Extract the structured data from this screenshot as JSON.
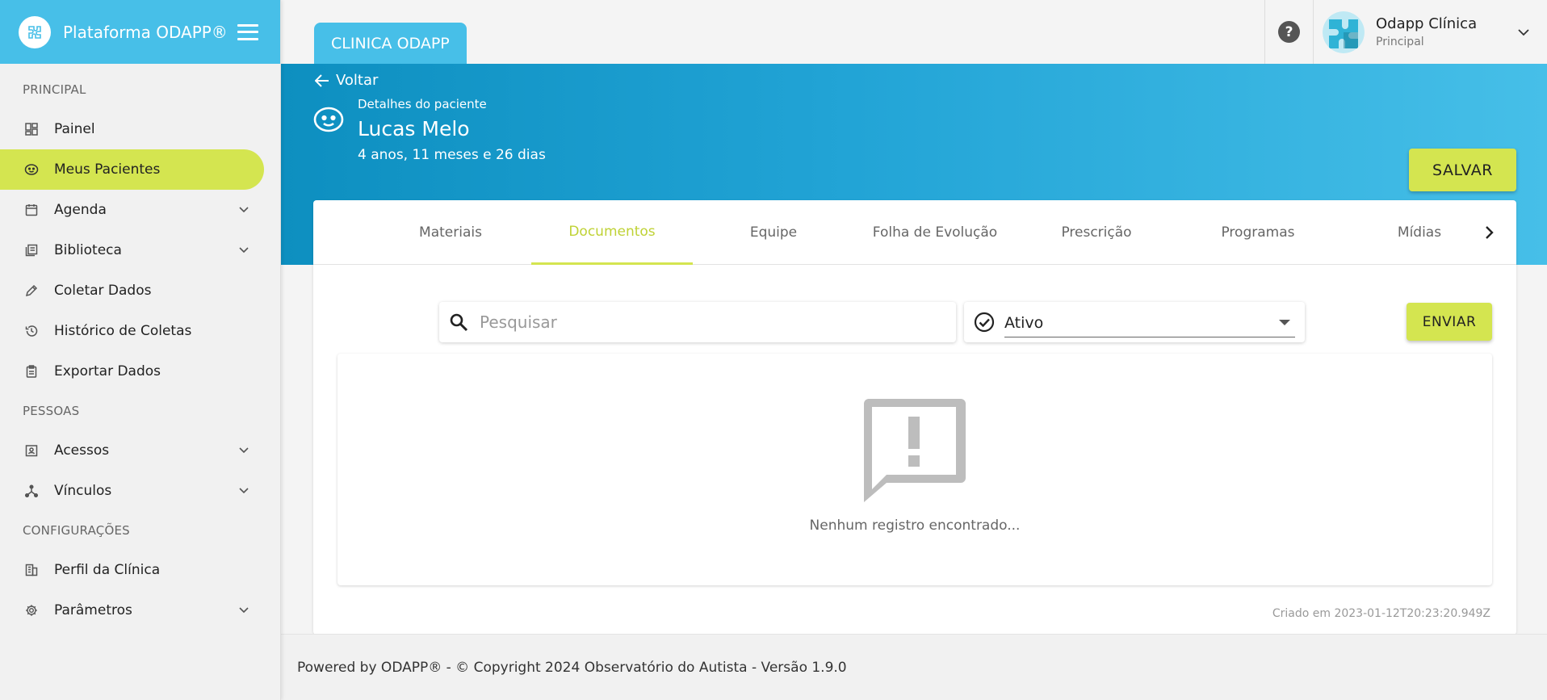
{
  "brand": {
    "title": "Plataforma ODAPP®"
  },
  "sidebar": {
    "sections": [
      {
        "label": "PRINCIPAL"
      },
      {
        "label": "PESSOAS"
      },
      {
        "label": "CONFIGURAÇÕES"
      }
    ],
    "items": [
      {
        "label": "Painel",
        "icon": "dashboard-icon",
        "active": false,
        "expandable": false
      },
      {
        "label": "Meus Pacientes",
        "icon": "patient-face-icon",
        "active": true,
        "expandable": false
      },
      {
        "label": "Agenda",
        "icon": "calendar-icon",
        "active": false,
        "expandable": true
      },
      {
        "label": "Biblioteca",
        "icon": "library-icon",
        "active": false,
        "expandable": true
      },
      {
        "label": "Coletar Dados",
        "icon": "pencil-icon",
        "active": false,
        "expandable": false
      },
      {
        "label": "Histórico de Coletas",
        "icon": "history-icon",
        "active": false,
        "expandable": false
      },
      {
        "label": "Exportar Dados",
        "icon": "clipboard-icon",
        "active": false,
        "expandable": false
      },
      {
        "label": "Acessos",
        "icon": "contact-card-icon",
        "active": false,
        "expandable": true
      },
      {
        "label": "Vínculos",
        "icon": "network-icon",
        "active": false,
        "expandable": true
      },
      {
        "label": "Perfil da Clínica",
        "icon": "building-icon",
        "active": false,
        "expandable": false
      },
      {
        "label": "Parâmetros",
        "icon": "gear-icon",
        "active": false,
        "expandable": true
      }
    ]
  },
  "topbar": {
    "clinic_tab": "CLINICA ODAPP",
    "user": {
      "name": "Odapp Clínica",
      "role": "Principal"
    }
  },
  "header": {
    "back_label": "Voltar",
    "caption": "Detalhes do paciente",
    "patient_name": "Lucas Melo",
    "patient_age": "4 anos, 11 meses e 26 dias",
    "save_label": "SALVAR"
  },
  "tabs": [
    {
      "label": "Materiais",
      "active": false
    },
    {
      "label": "Documentos",
      "active": true
    },
    {
      "label": "Equipe",
      "active": false
    },
    {
      "label": "Folha de Evolução",
      "active": false
    },
    {
      "label": "Prescrição",
      "active": false
    },
    {
      "label": "Programas",
      "active": false
    },
    {
      "label": "Mídias",
      "active": false
    }
  ],
  "toolbar": {
    "search_placeholder": "Pesquisar",
    "status_value": "Ativo",
    "send_label": "ENVIAR"
  },
  "empty_state": {
    "message": "Nenhum registro encontrado..."
  },
  "created_at": "Criado em 2023-01-12T20:23:20.949Z",
  "footer": {
    "text": "Powered by ODAPP® - © Copyright 2024 Observatório do Autista - Versão 1.9.0"
  },
  "colors": {
    "accent": "#d4e550",
    "brand": "#47bfe8",
    "banner_dark": "#0d8fc0"
  }
}
